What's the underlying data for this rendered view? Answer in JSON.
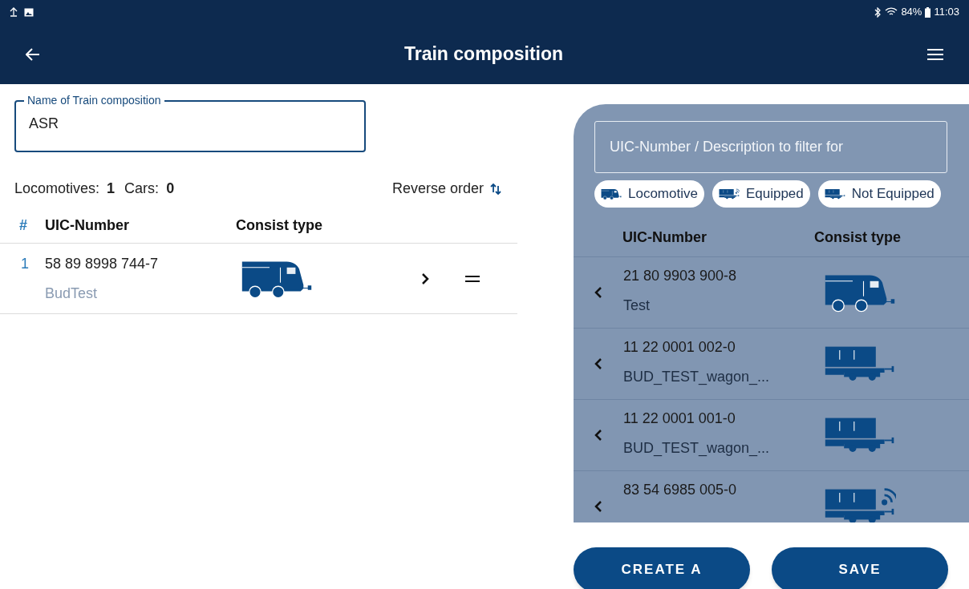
{
  "status_bar": {
    "time": "11:03",
    "battery": "84%"
  },
  "app_bar": {
    "title": "Train composition"
  },
  "name_field": {
    "label": "Name of Train composition",
    "value": "ASR"
  },
  "counts": [
    {
      "label": "Locomotives:",
      "value": "1"
    },
    {
      "label": "Cars:",
      "value": "0"
    }
  ],
  "reverse_order": {
    "label": "Reverse order"
  },
  "composition": {
    "columns": [
      "#",
      "UIC-Number",
      "Consist type"
    ],
    "rows": [
      {
        "index": "1",
        "number": "58 89 8998 744-7",
        "description": "BudTest",
        "kind": "locomotive"
      }
    ]
  },
  "catalog": {
    "filter": {
      "placeholder": "UIC-Number / Description to filter for"
    },
    "chips": [
      {
        "label": "Locomotive",
        "kind": "locomotive"
      },
      {
        "label": "Equipped",
        "kind": "wagon_equipped"
      },
      {
        "label": "Not Equipped",
        "kind": "wagon"
      }
    ],
    "columns": [
      "UIC-Number",
      "Consist type"
    ],
    "rows": [
      {
        "number": "21 80 9903 900-8",
        "description": "Test",
        "kind": "locomotive"
      },
      {
        "number": "11 22 0001 002-0",
        "description": "BUD_TEST_wagon_...",
        "kind": "wagon"
      },
      {
        "number": "11 22 0001 001-0",
        "description": "BUD_TEST_wagon_...",
        "kind": "wagon"
      },
      {
        "number": "83 54 6985 005-0",
        "kind": "wagon_equipped"
      }
    ]
  },
  "buttons": [
    {
      "label": "CREATE A"
    },
    {
      "label": "SAVE"
    }
  ]
}
